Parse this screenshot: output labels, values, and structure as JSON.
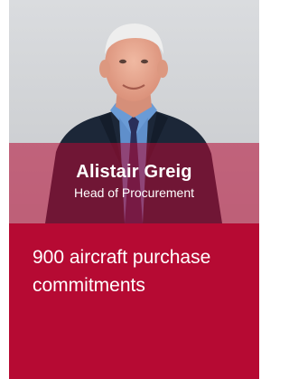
{
  "profile": {
    "name": "Alistair Greig",
    "role": "Head of Procurement",
    "commitment_line1": "900 aircraft purchase",
    "commitment_line2": "commitments"
  },
  "colors": {
    "accent": "#b60a33",
    "photo_background": "#d5d7da",
    "text": "#ffffff"
  }
}
